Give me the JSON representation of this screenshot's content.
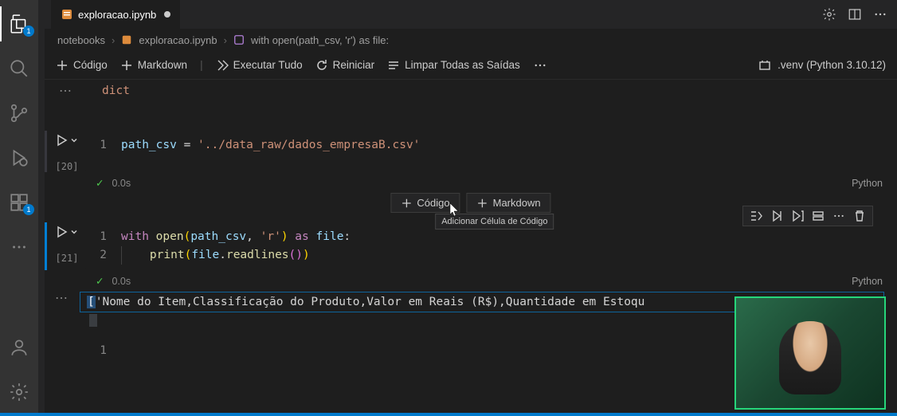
{
  "tab": {
    "title": "exploracao.ipynb"
  },
  "breadcrumb": {
    "folder": "notebooks",
    "file": "exploracao.ipynb",
    "symbol": "with open(path_csv, 'r') as file:"
  },
  "toolbar": {
    "code": "Código",
    "markdown": "Markdown",
    "runAll": "Executar Tudo",
    "restart": "Reiniciar",
    "clearAll": "Limpar Todas as Saídas",
    "kernel": ".venv (Python 3.10.12)"
  },
  "topOutput": "dict",
  "cell1": {
    "line1_var": "path_csv",
    "line1_op": " = ",
    "line1_str": "'../data_raw/dados_empresaB.csv'",
    "exec": "[20]",
    "time": "0.0s",
    "lang": "Python"
  },
  "addBar": {
    "code": "Código",
    "markdown": "Markdown",
    "tooltip": "Adicionar Célula de Código"
  },
  "cell2": {
    "l1_kw1": "with",
    "l1_fn": "open",
    "l1_arg1": "path_csv",
    "l1_comma": ", ",
    "l1_str": "'r'",
    "l1_kw2": "as",
    "l1_var": "file",
    "l1_colon": ":",
    "l2_fn": "print",
    "l2_obj": "file",
    "l2_method": "readlines",
    "exec": "[21]",
    "time": "0.0s",
    "lang": "Python"
  },
  "output": {
    "open": "[",
    "text": "'Nome do Item,Classificação do Produto,Valor em Reais (R$),Quantidade em Estoqu"
  },
  "badges": {
    "explorer": "1",
    "extensions": "1"
  },
  "emptyCell": {
    "ln": "1"
  }
}
